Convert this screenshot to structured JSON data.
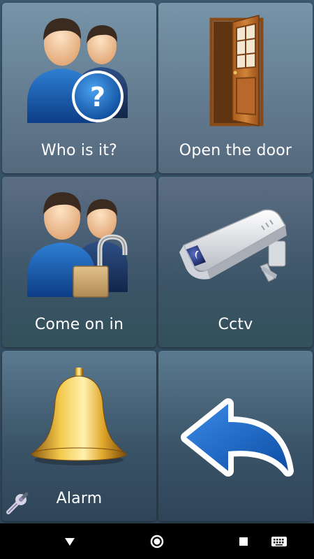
{
  "tiles": [
    {
      "label": "Who is it?",
      "icon": "two-persons-question-icon"
    },
    {
      "label": "Open the door",
      "icon": "open-door-icon"
    },
    {
      "label": "Come on in",
      "icon": "two-persons-padlock-icon"
    },
    {
      "label": "Cctv",
      "icon": "security-camera-icon"
    },
    {
      "label": "Alarm",
      "icon": "bell-icon"
    },
    {
      "label": "",
      "icon": "back-arrow-icon"
    }
  ],
  "settings": {
    "icon": "wrench-icon"
  },
  "navbar": {
    "back": "back-triangle-icon",
    "home": "home-circle-icon",
    "recents": "recents-square-icon",
    "keyboard": "keyboard-icon"
  },
  "colors": {
    "tile_top": "#7794a8",
    "tile_bottom": "#55697d",
    "accent_blue": "#1f6fbf",
    "label_text": "#ffffff",
    "navbar": "#000000"
  }
}
